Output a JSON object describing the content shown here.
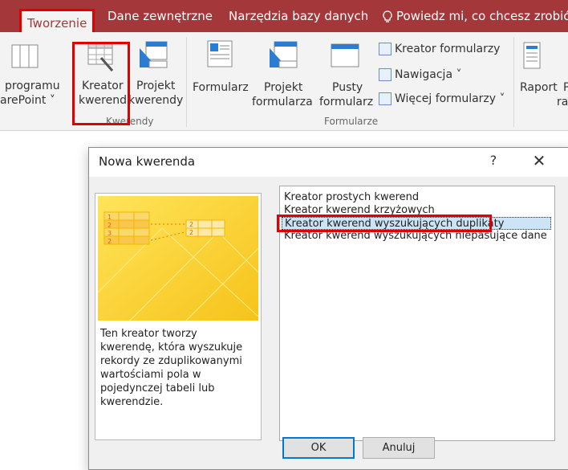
{
  "tabs": [
    {
      "label": "Tworzenie",
      "active": true
    },
    {
      "label": "Dane zewnętrzne"
    },
    {
      "label": "Narzędzia bazy danych"
    }
  ],
  "tell_me": "Powiedz mi, co chcesz zrobić...",
  "ribbon": {
    "sharepoint": {
      "line1": "programu",
      "line2": "arePoint ˅"
    },
    "kreator_kwerend": {
      "line1": "Kreator",
      "line2": "kwerend"
    },
    "projekt_kwerendy": {
      "line1": "Projekt",
      "line2": "kwerendy"
    },
    "kwerendy_group": "Kwerendy",
    "formularz": "Formularz",
    "projekt_formularza": {
      "line1": "Projekt",
      "line2": "formularza"
    },
    "pusty_formularz": {
      "line1": "Pusty",
      "line2": "formularz"
    },
    "kreator_formularzy": "Kreator formularzy",
    "nawigacja": "Nawigacja ˅",
    "wiecej_formularzy": "Więcej formularzy ˅",
    "formularze_group": "Formularze",
    "raport": "Raport",
    "raport_next": {
      "line1": "P",
      "line2": "ra"
    }
  },
  "dialog": {
    "title": "Nowa kwerenda",
    "help": "?",
    "close": "✕",
    "description": "Ten kreator tworzy kwerendę, która wyszukuje rekordy ze zduplikowanymi wartościami pola w pojedynczej tabeli lub kwerendzie.",
    "options": [
      "Kreator prostych kwerend",
      "Kreator kwerend krzyżowych",
      "Kreator kwerend wyszukujących duplikaty",
      "Kreator kwerend wyszukujących niepasujące dane"
    ],
    "selected_index": 2,
    "ok": "OK",
    "cancel": "Anuluj"
  },
  "colors": {
    "titlebar": "#a4373a",
    "highlight": "#e00000",
    "selection": "#cce4f7"
  }
}
